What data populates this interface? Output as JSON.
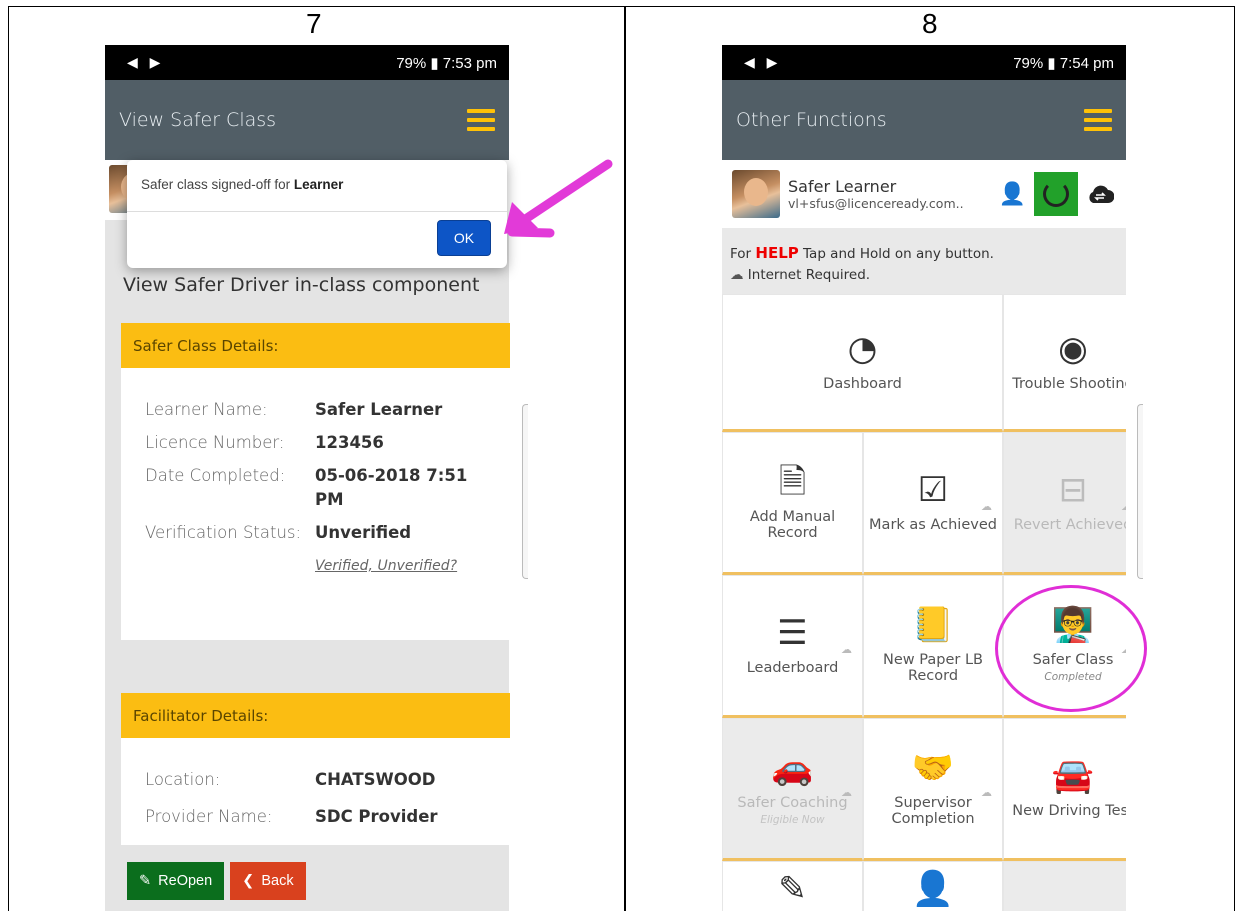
{
  "panels": {
    "left_number": "7",
    "right_number": "8"
  },
  "left": {
    "status": {
      "icons_left": "◀ ▶",
      "right": "79% ▮ 7:53 pm"
    },
    "title": "View Safer Class",
    "dialog": {
      "message": "Safer class signed-off for ",
      "message_bold": "Learner",
      "ok_label": "OK"
    },
    "heading": "View Safer Driver in-class component",
    "class_details": {
      "header": "Safer Class Details:",
      "rows": [
        {
          "k": "Learner Name:",
          "v": "Safer Learner"
        },
        {
          "k": "Licence Number:",
          "v": "123456"
        },
        {
          "k": "Date Completed:",
          "v": "05-06-2018 7:51 PM"
        },
        {
          "k": "Verification Status:",
          "v": "Unverified"
        }
      ],
      "verify_link": "Verified, Unverified?"
    },
    "facilitator_details": {
      "header": "Facilitator Details:",
      "rows": [
        {
          "k": "Location:",
          "v": "CHATSWOOD"
        },
        {
          "k": "Provider Name:",
          "v": "SDC Provider"
        }
      ]
    },
    "buttons": {
      "reopen": "ReOpen",
      "back": "Back"
    }
  },
  "right": {
    "status": {
      "icons_left": "◀ ▶",
      "right": "79% ▮ 7:54 pm"
    },
    "title": "Other Functions",
    "user": {
      "name": "Safer Learner",
      "email": "vl+sfus@licenceready.com.."
    },
    "help": {
      "prefix": "For ",
      "help_word": "HELP",
      "suffix": " Tap and Hold on any button.",
      "internet": "Internet Required."
    },
    "tiles": {
      "dashboard": "Dashboard",
      "trouble": "Trouble Shooting",
      "add_manual": "Add Manual Record",
      "mark_achieved": "Mark as Achieved",
      "revert": "Revert Achieved",
      "leaderboard": "Leaderboard",
      "paper_lb": "New Paper LB Record",
      "safer_class": "Safer Class",
      "safer_class_sub": "Completed",
      "safer_coaching": "Safer Coaching",
      "safer_coaching_sub": "Eligible Now",
      "supervisor": "Supervisor Completion",
      "driving_test": "New Driving Test"
    }
  },
  "colors": {
    "accent": "#fbbd12",
    "appbar": "#515e66",
    "highlight": "#e02ed6"
  }
}
